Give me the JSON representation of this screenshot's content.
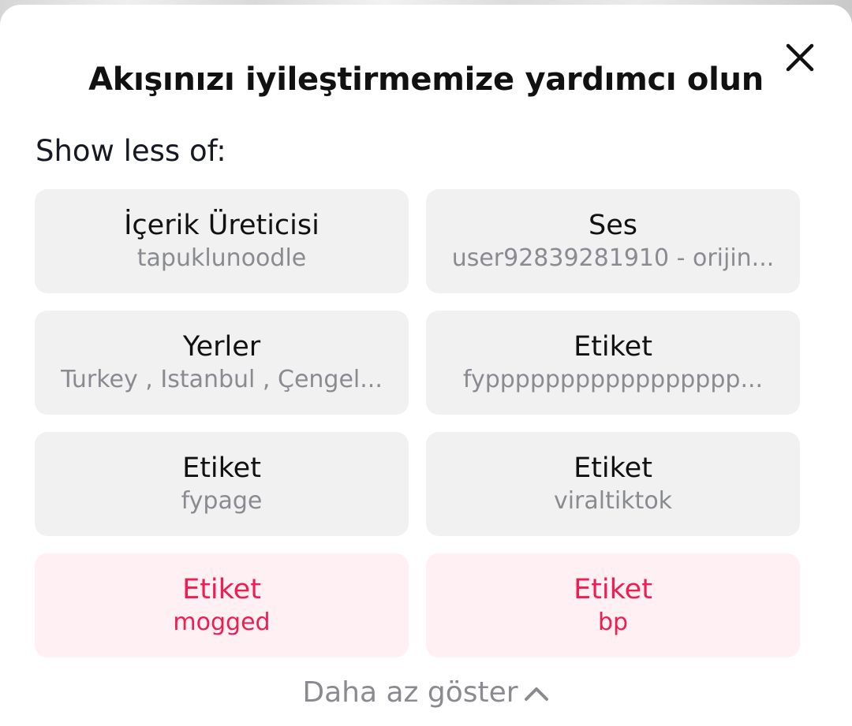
{
  "dialog": {
    "title": "Akışınızı iyileştirmemize yardımcı olun",
    "subheading": "Show less of:",
    "close_icon": "close-icon"
  },
  "options": [
    {
      "label": "İçerik Üreticisi",
      "value": "tapuklunoodle",
      "selected": false
    },
    {
      "label": "Ses",
      "value": "user92839281910 - orijin...",
      "selected": false
    },
    {
      "label": "Yerler",
      "value": "Turkey , Istanbul , Çengel...",
      "selected": false
    },
    {
      "label": "Etiket",
      "value": "fyppppppppppppppppp...",
      "selected": false
    },
    {
      "label": "Etiket",
      "value": "fypage",
      "selected": false
    },
    {
      "label": "Etiket",
      "value": "viraltiktok",
      "selected": false
    },
    {
      "label": "Etiket",
      "value": "mogged",
      "selected": true
    },
    {
      "label": "Etiket",
      "value": "bp",
      "selected": true
    }
  ],
  "footer": {
    "show_less_label": "Daha az göster",
    "icon": "chevron-up-icon"
  },
  "colors": {
    "card_bg": "#f1f1f2",
    "selected_bg": "#fef0f3",
    "accent": "#ee1d52",
    "secondary_text": "#8a8b91"
  }
}
